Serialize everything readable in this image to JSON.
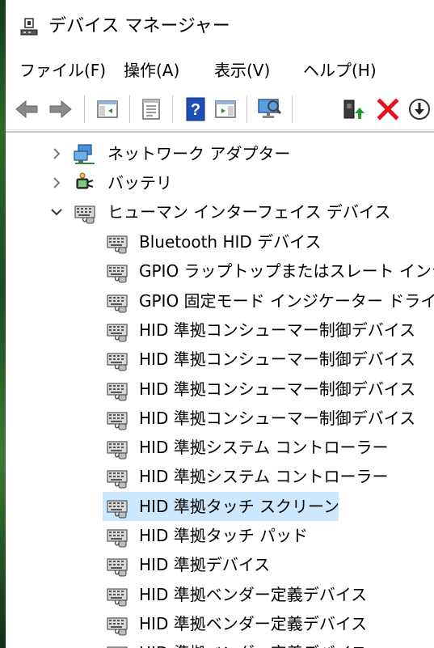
{
  "window": {
    "title": "デバイス マネージャー"
  },
  "menu": [
    {
      "label": "ファイル(F)"
    },
    {
      "label": "操作(A)"
    },
    {
      "label": "表示(V)"
    },
    {
      "label": "ヘルプ(H)"
    }
  ],
  "toolbar": {
    "buttons": [
      {
        "name": "back-icon"
      },
      {
        "name": "forward-icon"
      },
      {
        "name": "show-hide-console-tree-icon"
      },
      {
        "name": "properties-icon"
      },
      {
        "name": "help-icon"
      },
      {
        "name": "action-pane-icon"
      },
      {
        "name": "scan-hardware-icon"
      },
      {
        "name": "update-driver-icon"
      },
      {
        "name": "uninstall-icon"
      },
      {
        "name": "disable-device-icon"
      }
    ]
  },
  "tree": {
    "categories": [
      {
        "label": "ネットワーク アダプター",
        "expanded": false,
        "icon": "network-adapter-icon"
      },
      {
        "label": "バッテリ",
        "expanded": false,
        "icon": "battery-icon"
      },
      {
        "label": "ヒューマン インターフェイス デバイス",
        "expanded": true,
        "icon": "hid-icon"
      }
    ],
    "devices": [
      {
        "label": "Bluetooth HID デバイス"
      },
      {
        "label": "GPIO ラップトップまたはスレート インジケーター ドライバー"
      },
      {
        "label": "GPIO 固定モード インジケーター ドライバー"
      },
      {
        "label": "HID 準拠コンシューマー制御デバイス"
      },
      {
        "label": "HID 準拠コンシューマー制御デバイス"
      },
      {
        "label": "HID 準拠コンシューマー制御デバイス"
      },
      {
        "label": "HID 準拠コンシューマー制御デバイス"
      },
      {
        "label": "HID 準拠システム コントローラー"
      },
      {
        "label": "HID 準拠システム コントローラー"
      },
      {
        "label": "HID 準拠タッチ スクリーン",
        "selected": true
      },
      {
        "label": "HID 準拠タッチ パッド"
      },
      {
        "label": "HID 準拠デバイス"
      },
      {
        "label": "HID 準拠ベンダー定義デバイス"
      },
      {
        "label": "HID 準拠ベンダー定義デバイス"
      },
      {
        "label": "HID 準拠ベンダー定義デバイス"
      }
    ]
  },
  "colors": {
    "selection": "#cce8ff",
    "help": "#1f4fb5",
    "delete": "#e81123",
    "update": "#1a9e2f"
  }
}
